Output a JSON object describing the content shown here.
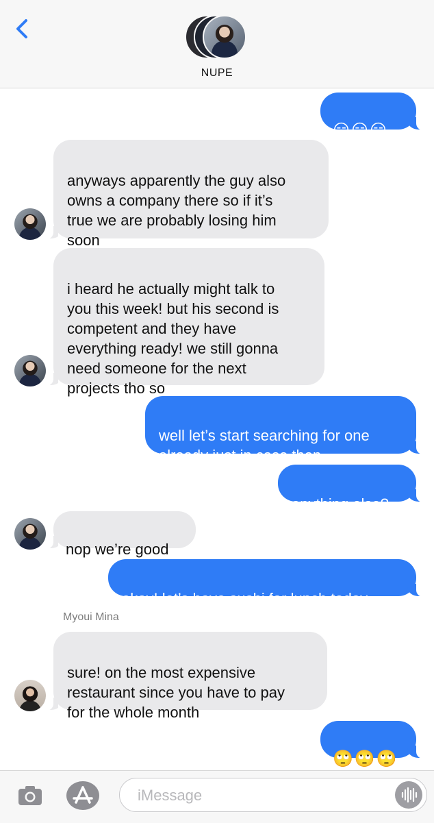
{
  "header": {
    "contact_name": "NUPE",
    "back_icon": "chevron-left-icon",
    "accent": "#2f7cf6"
  },
  "messages": [
    {
      "dir": "out",
      "text": "😑😑😑"
    },
    {
      "dir": "in",
      "text": "anyways apparently the guy also\nowns a company there so if it’s\ntrue we are probably losing him\nsoon"
    },
    {
      "dir": "in",
      "text": "i heard he actually might talk to\nyou this week! but his second is\ncompetent and they have\neverything ready! we still gonna\nneed someone for the next\nprojects tho so"
    },
    {
      "dir": "out",
      "text": "well let’s start searching for one\nalready just in case then"
    },
    {
      "dir": "out",
      "text": "anything else?"
    },
    {
      "dir": "in",
      "text": "nop we’re good"
    },
    {
      "dir": "out",
      "text": "okay! let’s have sushi for lunch today"
    },
    {
      "dir": "in",
      "sender": "Myoui Mina",
      "text": "sure! on the most expensive\nrestaurant since you have to pay\nfor the whole month"
    },
    {
      "dir": "out",
      "text": "🙄🙄🙄"
    }
  ],
  "input_bar": {
    "placeholder": "iMessage",
    "camera_icon": "camera-icon",
    "apps_icon": "app-store-icon",
    "audio_icon": "audio-waveform-icon"
  },
  "colors": {
    "outgoing": "#2f7cf6",
    "incoming": "#e9e9eb"
  }
}
